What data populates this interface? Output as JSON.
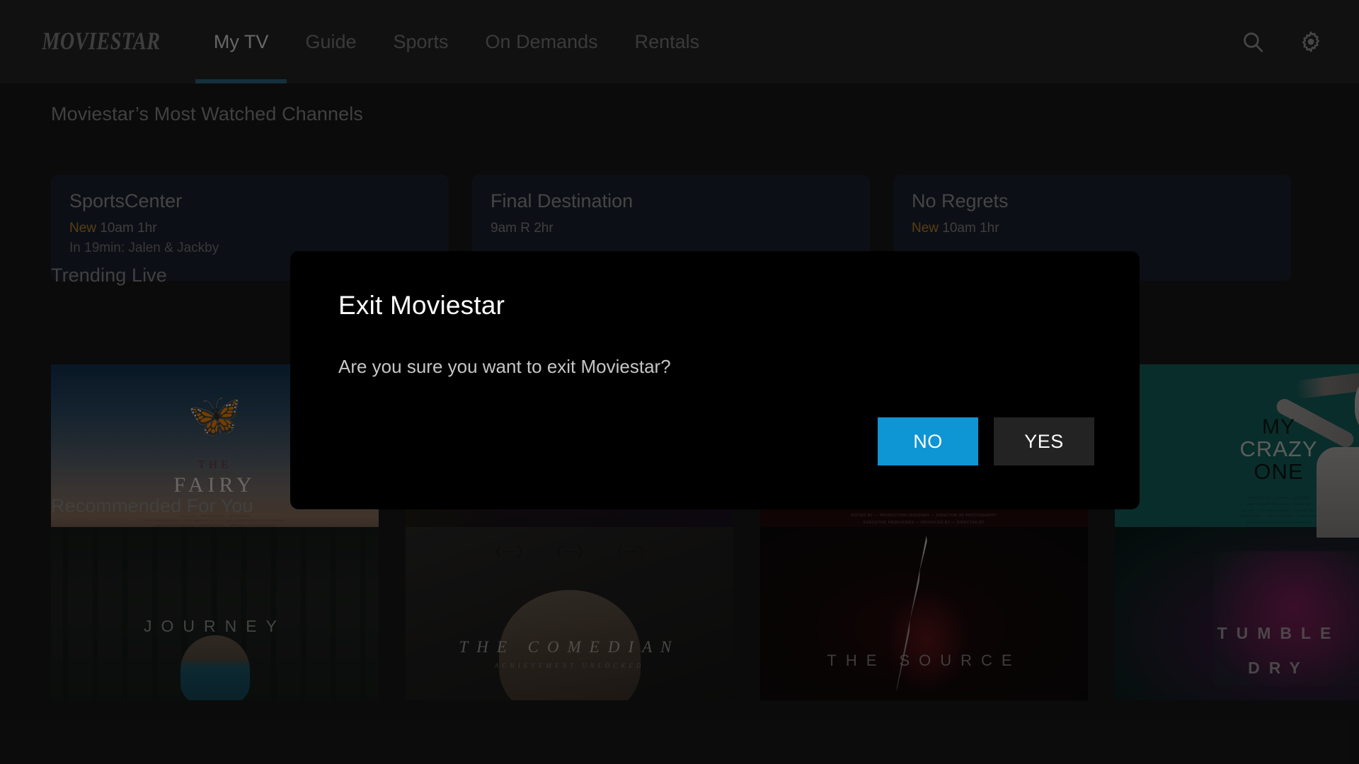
{
  "nav": {
    "brand": "MOVIESTAR",
    "items": [
      {
        "label": "My TV",
        "active": true
      },
      {
        "label": "Guide",
        "active": false
      },
      {
        "label": "Sports",
        "active": false
      },
      {
        "label": "On Demands",
        "active": false
      },
      {
        "label": "Rentals",
        "active": false
      }
    ],
    "icons": [
      {
        "name": "search-icon",
        "label": "Search"
      },
      {
        "name": "gear-icon",
        "label": "Settings"
      }
    ]
  },
  "sections": {
    "channels": {
      "title": "Moviestar’s Most Watched Channels",
      "cards": [
        {
          "name": "SportsCenter",
          "badge": "New",
          "meta": "10am 1hr",
          "sub": "In 19min: Jalen & Jackby"
        },
        {
          "name": "Final Destination",
          "badge": "",
          "meta": "9am R 2hr",
          "sub": ""
        },
        {
          "name": "No Regrets",
          "badge": "New",
          "meta": "10am 1hr",
          "sub": ""
        }
      ]
    },
    "trending": {
      "title": "Trending Live",
      "posters": [
        {
          "title_top": "THE",
          "title": "FAIRY",
          "subtitle": "",
          "art": "butterfly-sky"
        },
        {
          "title_top": "",
          "title": "",
          "subtitle": "",
          "art": "dark-purple-forest"
        },
        {
          "title_top": "",
          "title": "",
          "subtitle": "",
          "art": "deep-red"
        },
        {
          "title_top": "MY",
          "title": "CRAZY",
          "subtitle": "ONE",
          "art": "teal-portrait"
        }
      ]
    },
    "recommended": {
      "title": "Recommended For You",
      "posters": [
        {
          "title": "JOURNEY",
          "subtitle": "",
          "art": "foggy-forest"
        },
        {
          "title": "THE COMEDIAN",
          "subtitle": "ACHIEVEMENT UNLOCKED",
          "art": "portrait-laurels"
        },
        {
          "title": "THE SOURCE",
          "subtitle": "",
          "art": "lightning-red"
        },
        {
          "title": "TUMBLE",
          "subtitle": "DRY",
          "art": "magenta-teal-splat"
        }
      ]
    }
  },
  "modal": {
    "title": "Exit Moviestar",
    "message": "Are you sure you want to exit Moviestar?",
    "buttons": {
      "no": "NO",
      "yes": "YES"
    }
  },
  "colors": {
    "accent_blue": "#0e95d3",
    "nav_underline": "#2b6a87",
    "badge_new": "#c08a2a",
    "page_bg": "#1a1a1a",
    "navbar_bg": "#262626",
    "card_bg": "#1e2231",
    "modal_bg": "#000000",
    "yes_button": "#232323"
  }
}
